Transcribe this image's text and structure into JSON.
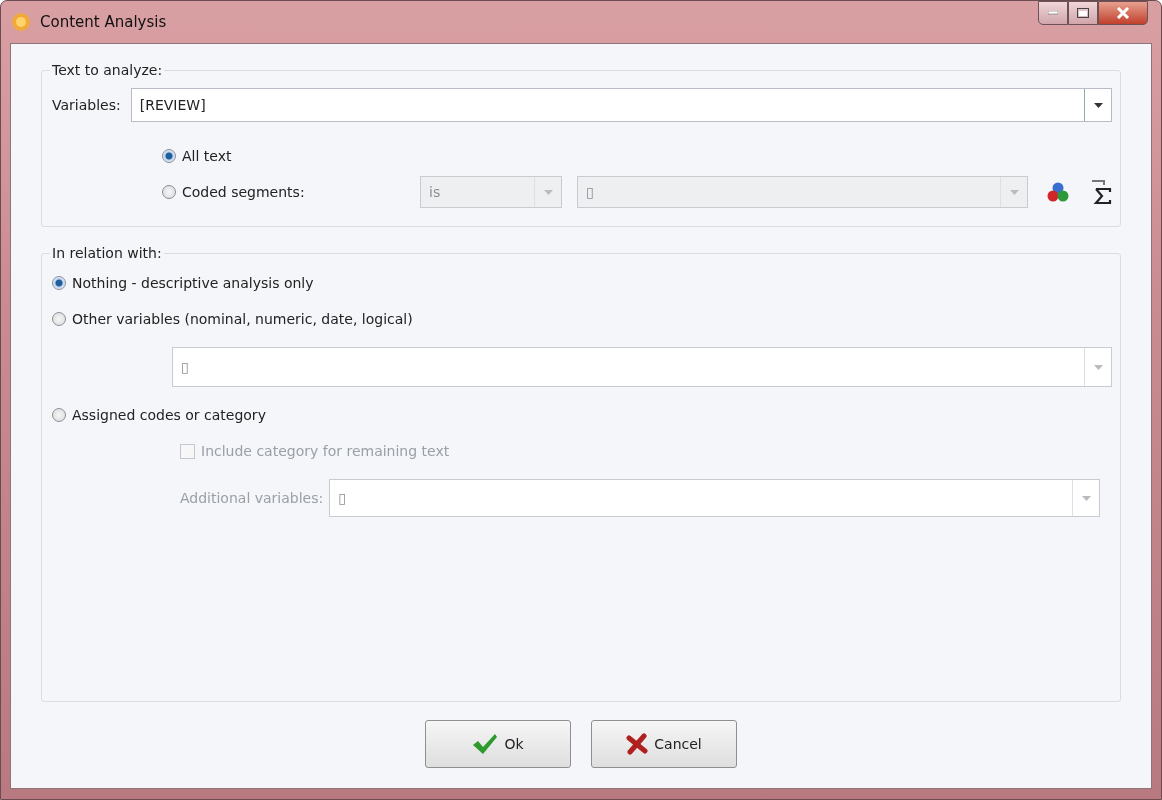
{
  "window": {
    "title": "Content Analysis"
  },
  "text_to_analyze": {
    "title": "Text to analyze:",
    "variables_label": "Variables:",
    "variables_value": "[REVIEW]",
    "scope_options": [
      {
        "label": "All text",
        "selected": true
      },
      {
        "label": "Coded segments:",
        "selected": false
      }
    ],
    "operator": {
      "value": "is",
      "disabled": true
    },
    "code_value": {
      "value": "▯",
      "disabled": true
    }
  },
  "in_relation_with": {
    "title": "In relation with:",
    "options": [
      {
        "label": "Nothing - descriptive analysis only",
        "selected": true
      },
      {
        "label": "Other variables (nominal, numeric, date, logical)",
        "selected": false
      },
      {
        "label": "Assigned codes or category",
        "selected": false
      }
    ],
    "other_variables": {
      "value": "▯",
      "disabled": true
    },
    "include_category": {
      "label": "Include category for remaining text",
      "checked": false,
      "disabled": true
    },
    "additional_variables": {
      "label": "Additional variables:",
      "value": "▯",
      "disabled": true
    }
  },
  "buttons": [
    {
      "label": "Ok",
      "kind": "ok"
    },
    {
      "label": "Cancel",
      "kind": "cancel"
    }
  ]
}
